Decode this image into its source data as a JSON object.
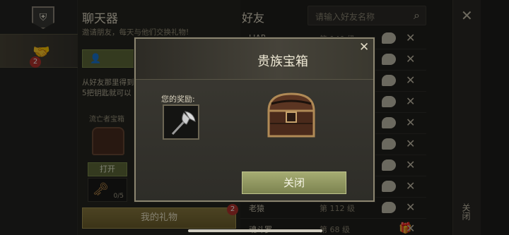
{
  "colors": {
    "accent_green": "#7c8350",
    "badge_red": "#b3322c",
    "modal_border": "#8b8570"
  },
  "rail": {
    "logo_icon": "shield-icon",
    "friends_icon": "handshake-icon",
    "friends_badge": "2"
  },
  "chat": {
    "title": "聊天器",
    "subtitle": "邀请朋友，每天与他们交换礼物!",
    "desc_line1": "从好友那里得到",
    "desc_line2": "5把钥匙就可以",
    "chest_label": "流亡者宝箱",
    "open_label": "打开",
    "key_count": "0/5",
    "gift_button": "我的礼物",
    "gift_badge": "2"
  },
  "friends": {
    "title": "好友",
    "search_placeholder": "请输入好友名称",
    "rows": [
      {
        "name": "LIAR",
        "level": "第 140 级"
      },
      {
        "name": "",
        "level": ""
      },
      {
        "name": "",
        "level": ""
      },
      {
        "name": "",
        "level": ""
      },
      {
        "name": "",
        "level": ""
      },
      {
        "name": "",
        "level": ""
      },
      {
        "name": "",
        "level": ""
      },
      {
        "name": "",
        "level": ""
      },
      {
        "name": "老猿",
        "level": "第 112 级"
      },
      {
        "name": "魂斗罗",
        "level": "第 68 级"
      }
    ]
  },
  "close_panel": {
    "label": "关闭"
  },
  "modal": {
    "title": "贵族宝箱",
    "reward_label": "您的奖励:",
    "close_button": "关闭"
  }
}
